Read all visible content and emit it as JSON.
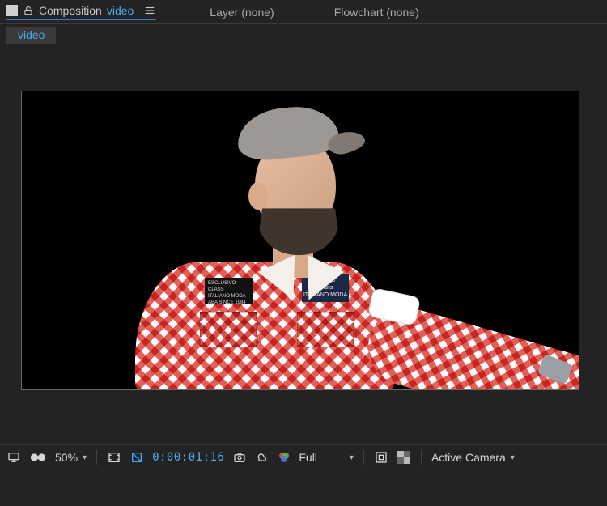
{
  "tabs": {
    "comp_label": "Composition",
    "comp_name": "video",
    "layer_label": "Layer (none)",
    "flow_label": "Flowchart (none)"
  },
  "breadcrumb": {
    "item": "video"
  },
  "patches": {
    "left_line1": "ESCLUSIVO CLASS",
    "left_line2": "ITALIANO MODA",
    "left_line3": "ABA SINCE 1984",
    "right_line1": "Jack 83",
    "right_line2": "Jeans",
    "right_line3": "ITALIANO MODA"
  },
  "toolbar": {
    "zoom": "50%",
    "timecode": "0:00:01:16",
    "resolution": "Full",
    "camera": "Active Camera"
  },
  "icons": {
    "lock": "lock-open-icon",
    "menu": "hamburger-icon",
    "monitor": "monitor-icon",
    "goggles": "goggles-icon",
    "bracket": "safe-zones-icon",
    "mask": "mask-toggle-icon",
    "camera": "snapshot-icon",
    "cloud": "preview-icon",
    "color": "color-mgmt-icon",
    "trans_grid": "transparency-grid-icon",
    "roi": "roi-icon",
    "chev": "chevron-down-icon"
  }
}
